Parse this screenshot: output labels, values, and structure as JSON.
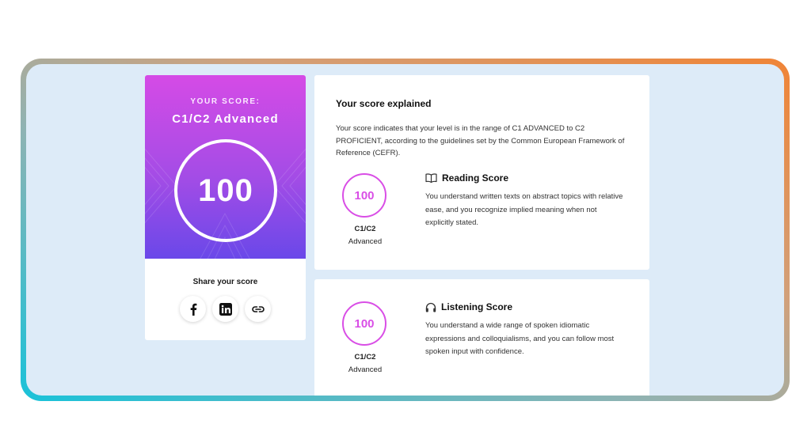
{
  "score_card": {
    "your_score_label": "YOUR SCORE:",
    "level": "C1/C2 Advanced",
    "score": "100",
    "share_label": "Share your score",
    "share_buttons": [
      {
        "icon": "facebook-icon"
      },
      {
        "icon": "linkedin-icon"
      },
      {
        "icon": "link-icon"
      }
    ]
  },
  "explained": {
    "title": "Your score explained",
    "description": "Your score indicates that your level is in the range of C1 ADVANCED to C2 PROFICIENT, according to the guidelines set by the Common European Framework of Reference (CEFR)."
  },
  "sections": [
    {
      "title": "Reading Score",
      "icon": "book-icon",
      "score": "100",
      "level_code": "C1/C2",
      "level_name": "Advanced",
      "description": "You understand written texts on abstract topics with relative ease, and you recognize implied meaning when not explicitly stated."
    },
    {
      "title": "Listening Score",
      "icon": "headphones-icon",
      "score": "100",
      "level_code": "C1/C2",
      "level_name": "Advanced",
      "description": "You understand a wide range of spoken idiomatic expressions and colloquialisms, and you can follow most spoken input with confidence."
    }
  ],
  "colors": {
    "accent": "#d94ee6",
    "card_gradient_top": "#d54be6",
    "card_gradient_bottom": "#6a48e9",
    "background": "#ddebf8"
  }
}
